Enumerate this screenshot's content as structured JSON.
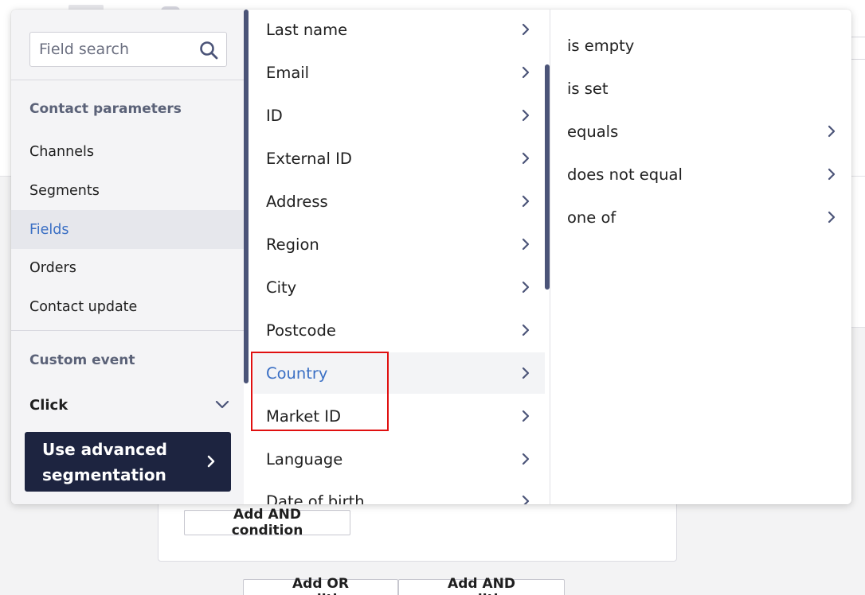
{
  "background": {
    "card_add_and_label": "Add AND condition",
    "add_or_label": "Add OR condition",
    "add_and_label": "Add AND condition"
  },
  "left_panel": {
    "search_placeholder": "Field search",
    "contact_params_title": "Contact parameters",
    "items": [
      {
        "label": "Channels"
      },
      {
        "label": "Segments"
      },
      {
        "label": "Fields",
        "active": true
      },
      {
        "label": "Orders"
      },
      {
        "label": "Contact update"
      }
    ],
    "custom_event_title": "Custom event",
    "click_label": "Click",
    "advanced_line1": "Use advanced",
    "advanced_line2": "segmentation"
  },
  "fields": [
    {
      "label": "Last name"
    },
    {
      "label": "Email"
    },
    {
      "label": "ID"
    },
    {
      "label": "External ID"
    },
    {
      "label": "Address"
    },
    {
      "label": "Region"
    },
    {
      "label": "City"
    },
    {
      "label": "Postcode"
    },
    {
      "label": "Country",
      "selected": true
    },
    {
      "label": "Market ID"
    },
    {
      "label": "Language"
    },
    {
      "label": "Date of birth"
    }
  ],
  "operators": [
    {
      "label": "is empty",
      "has_submenu": false
    },
    {
      "label": "is set",
      "has_submenu": false
    },
    {
      "label": "equals",
      "has_submenu": true
    },
    {
      "label": "does not equal",
      "has_submenu": true
    },
    {
      "label": "one of",
      "has_submenu": true
    }
  ],
  "colors": {
    "accent": "#3a6fc4",
    "dark_button": "#1d2440",
    "highlight": "#e01010"
  }
}
